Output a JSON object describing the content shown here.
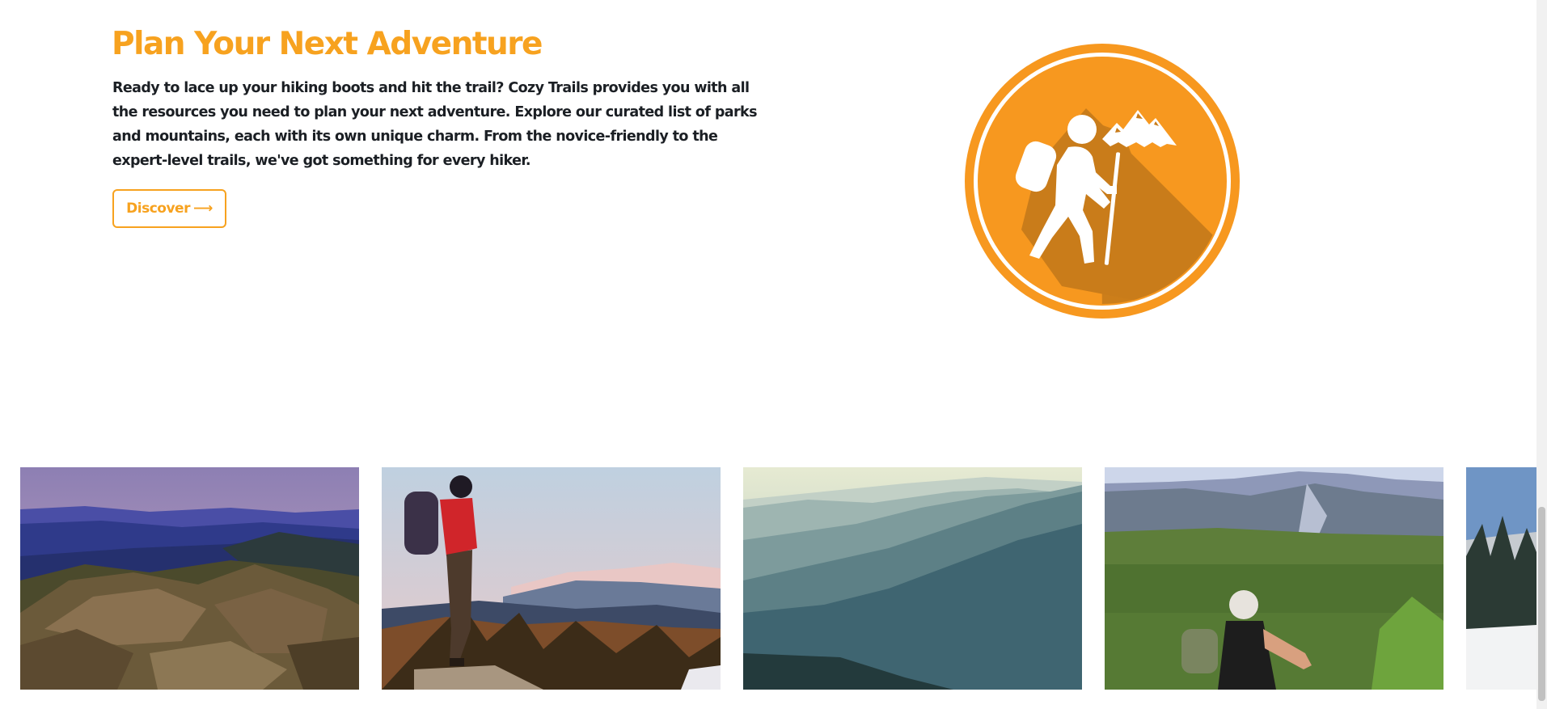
{
  "hero": {
    "title": "Plan Your Next Adventure",
    "body": "Ready to lace up your hiking boots and hit the trail? Cozy Trails provides you with all the resources you need to plan your next adventure. Explore our curated list of parks and mountains, each with its own unique charm. From the novice-friendly to the expert-level trails, we've got something for every hiker.",
    "cta_label": "Discover",
    "cta_arrow": "⟶"
  },
  "badge": {
    "icon": "hiker-icon"
  },
  "gallery": {
    "photos": [
      {
        "subject": "rocky-summit-sunset-photo"
      },
      {
        "subject": "hiker-red-jacket-photo"
      },
      {
        "subject": "misty-blue-ridges-photo"
      },
      {
        "subject": "hiker-green-valley-photo"
      },
      {
        "subject": "snowy-trees-photo"
      }
    ]
  },
  "colors": {
    "accent": "#f7a21f",
    "badge_shadow": "#c97c1a",
    "text": "#1b1f24"
  }
}
